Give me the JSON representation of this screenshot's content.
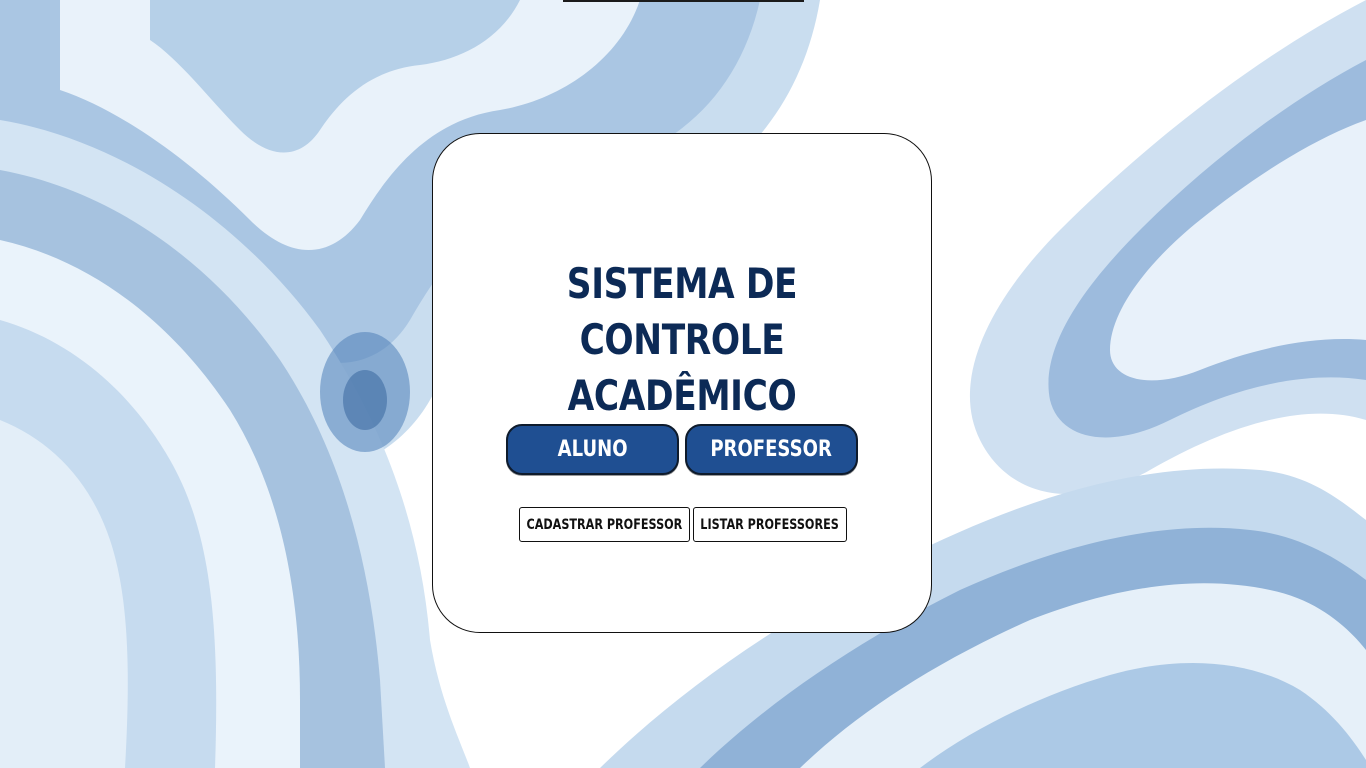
{
  "title": {
    "line1": "SISTEMA DE CONTROLE",
    "line2": "ACADÊMICO"
  },
  "buttons": {
    "aluno": "ALUNO",
    "professor": "PROFESSOR",
    "cadastrar_professor": "CADASTRAR PROFESSOR",
    "listar_professores": "LISTAR PROFESSORES"
  },
  "colors": {
    "title": "#0c2a56",
    "primary_button": "#1f4f92",
    "watercolor_light": "#cfe1f1",
    "watercolor_mid": "#7ea6d1",
    "watercolor_dark": "#3f6fa8"
  }
}
